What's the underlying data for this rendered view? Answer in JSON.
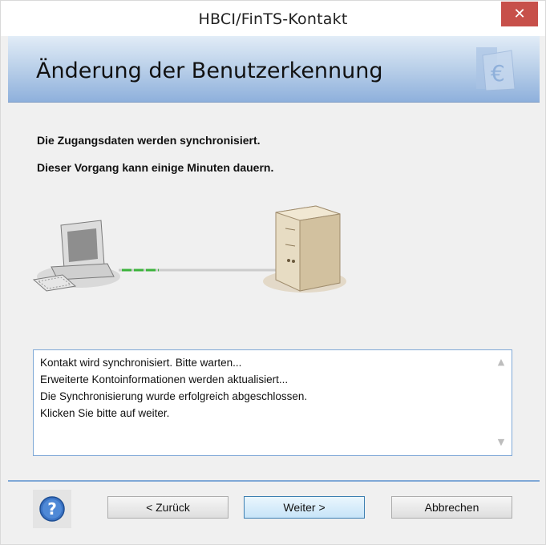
{
  "window": {
    "title": "HBCI/FinTS-Kontakt",
    "close_label": "✕"
  },
  "banner": {
    "title": "Änderung der Benutzerkennung"
  },
  "description": {
    "line1": "Die Zugangsdaten werden synchronisiert.",
    "line2": "Dieser Vorgang kann einige Minuten dauern."
  },
  "log": {
    "lines": [
      "Kontakt wird synchronisiert. Bitte warten...",
      "Erweiterte Kontoinformationen werden aktualisiert...",
      "Die Synchronisierung wurde erfolgreich abgeschlossen.",
      "Klicken Sie bitte auf weiter."
    ]
  },
  "buttons": {
    "back": "< Zurück",
    "next": "Weiter >",
    "cancel": "Abbrechen",
    "help_glyph": "?"
  },
  "colors": {
    "close_button": "#c7504a",
    "banner_bottom": "#8eb0dc",
    "connection_active": "#3cb33c",
    "accent_border": "#7fa8d6"
  },
  "icons": {
    "logo": "euro-document-icon",
    "computer": "computer-icon",
    "server": "server-icon",
    "help": "help-icon"
  }
}
